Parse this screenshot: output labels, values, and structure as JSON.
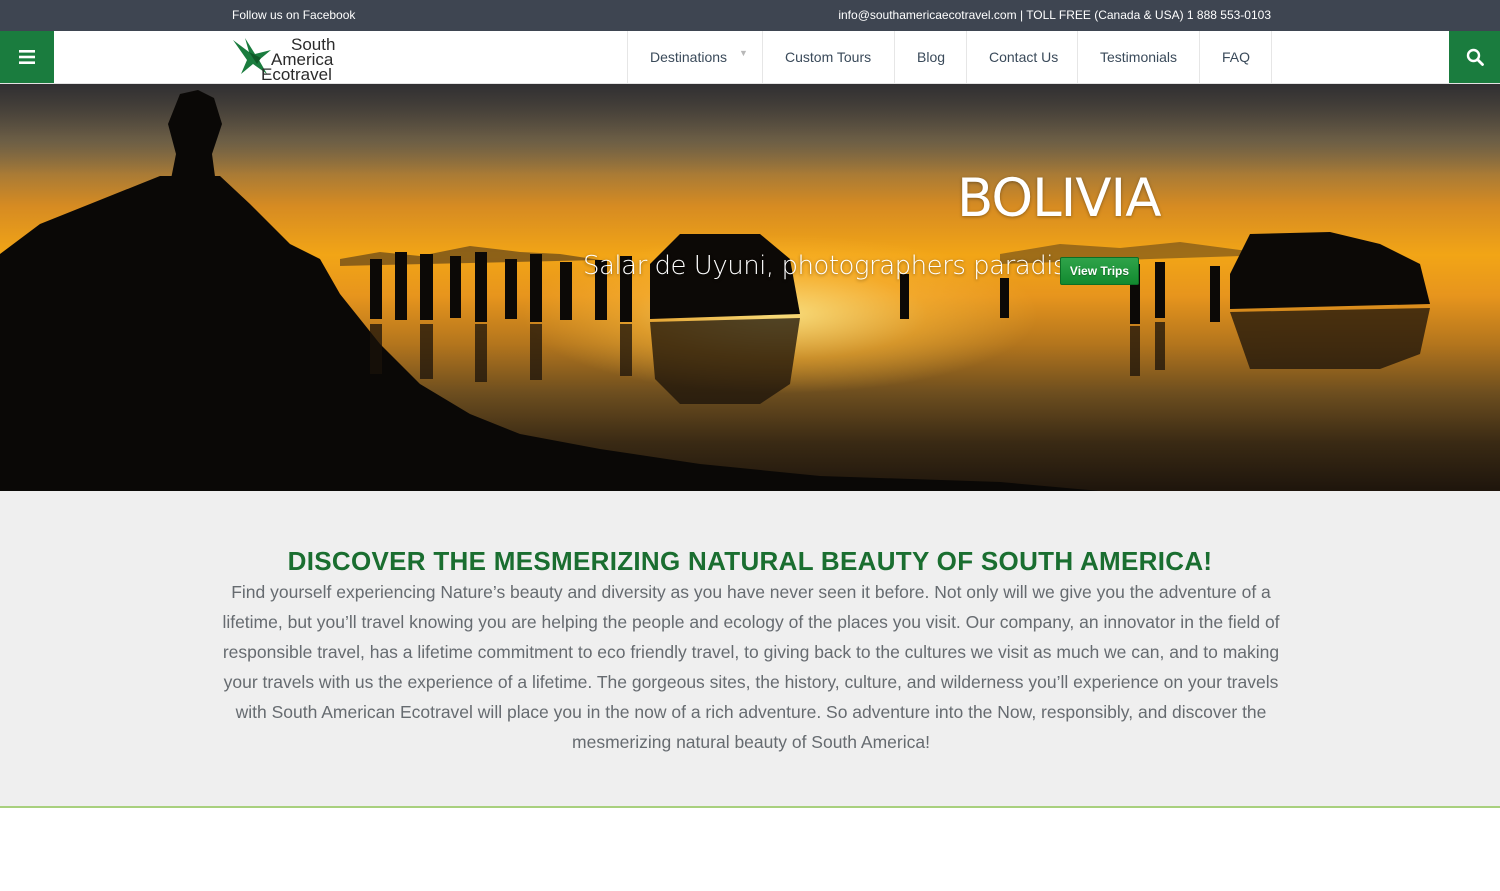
{
  "topbar": {
    "facebook_link": "Follow us on Facebook",
    "email": "info@southamericaecotravel.com",
    "separator": " | ",
    "toll_free": "TOLL FREE (Canada & USA) 1 888 553-0103"
  },
  "header": {
    "menu_icon": "hamburger-icon",
    "search_icon": "search-icon",
    "logo": {
      "line1": "South",
      "line2": "America",
      "line3": "Ecotravel",
      "icon": "bird-logo-icon"
    },
    "nav": [
      {
        "label": "Destinations",
        "has_dropdown": true
      },
      {
        "label": "Custom Tours"
      },
      {
        "label": "Blog"
      },
      {
        "label": "Contact Us"
      },
      {
        "label": "Testimonials"
      },
      {
        "label": "FAQ"
      }
    ]
  },
  "hero": {
    "title": "BOLIVIA",
    "subtitle": "Salar de Uyuni, photographers paradise",
    "button_label": "View Trips"
  },
  "intro": {
    "heading": "DISCOVER THE MESMERIZING NATURAL BEAUTY OF SOUTH AMERICA!",
    "body": "Find yourself experiencing  Nature’s beauty and diversity as you have never seen it before. Not only will we give you the adventure of a lifetime, but you’ll travel knowing you are helping the people and ecology of the places you visit.  Our company, an innovator in the field of responsible travel, has a lifetime commitment to eco friendly travel, to giving back to the cultures we visit as much we can, and to making your travels with us the experience of a lifetime. The gorgeous sites, the history, culture, and wilderness you’ll experience on your travels with South American Ecotravel will place you in the now of a rich adventure. So adventure into the Now, responsibly, and discover the mesmerizing natural beauty of South America!"
  },
  "colors": {
    "brand_green": "#1a7c3e",
    "heading_green": "#1a6e30",
    "topbar_bg": "#3e4551",
    "intro_bg": "#efefef",
    "accent_line": "#a8d07e"
  }
}
